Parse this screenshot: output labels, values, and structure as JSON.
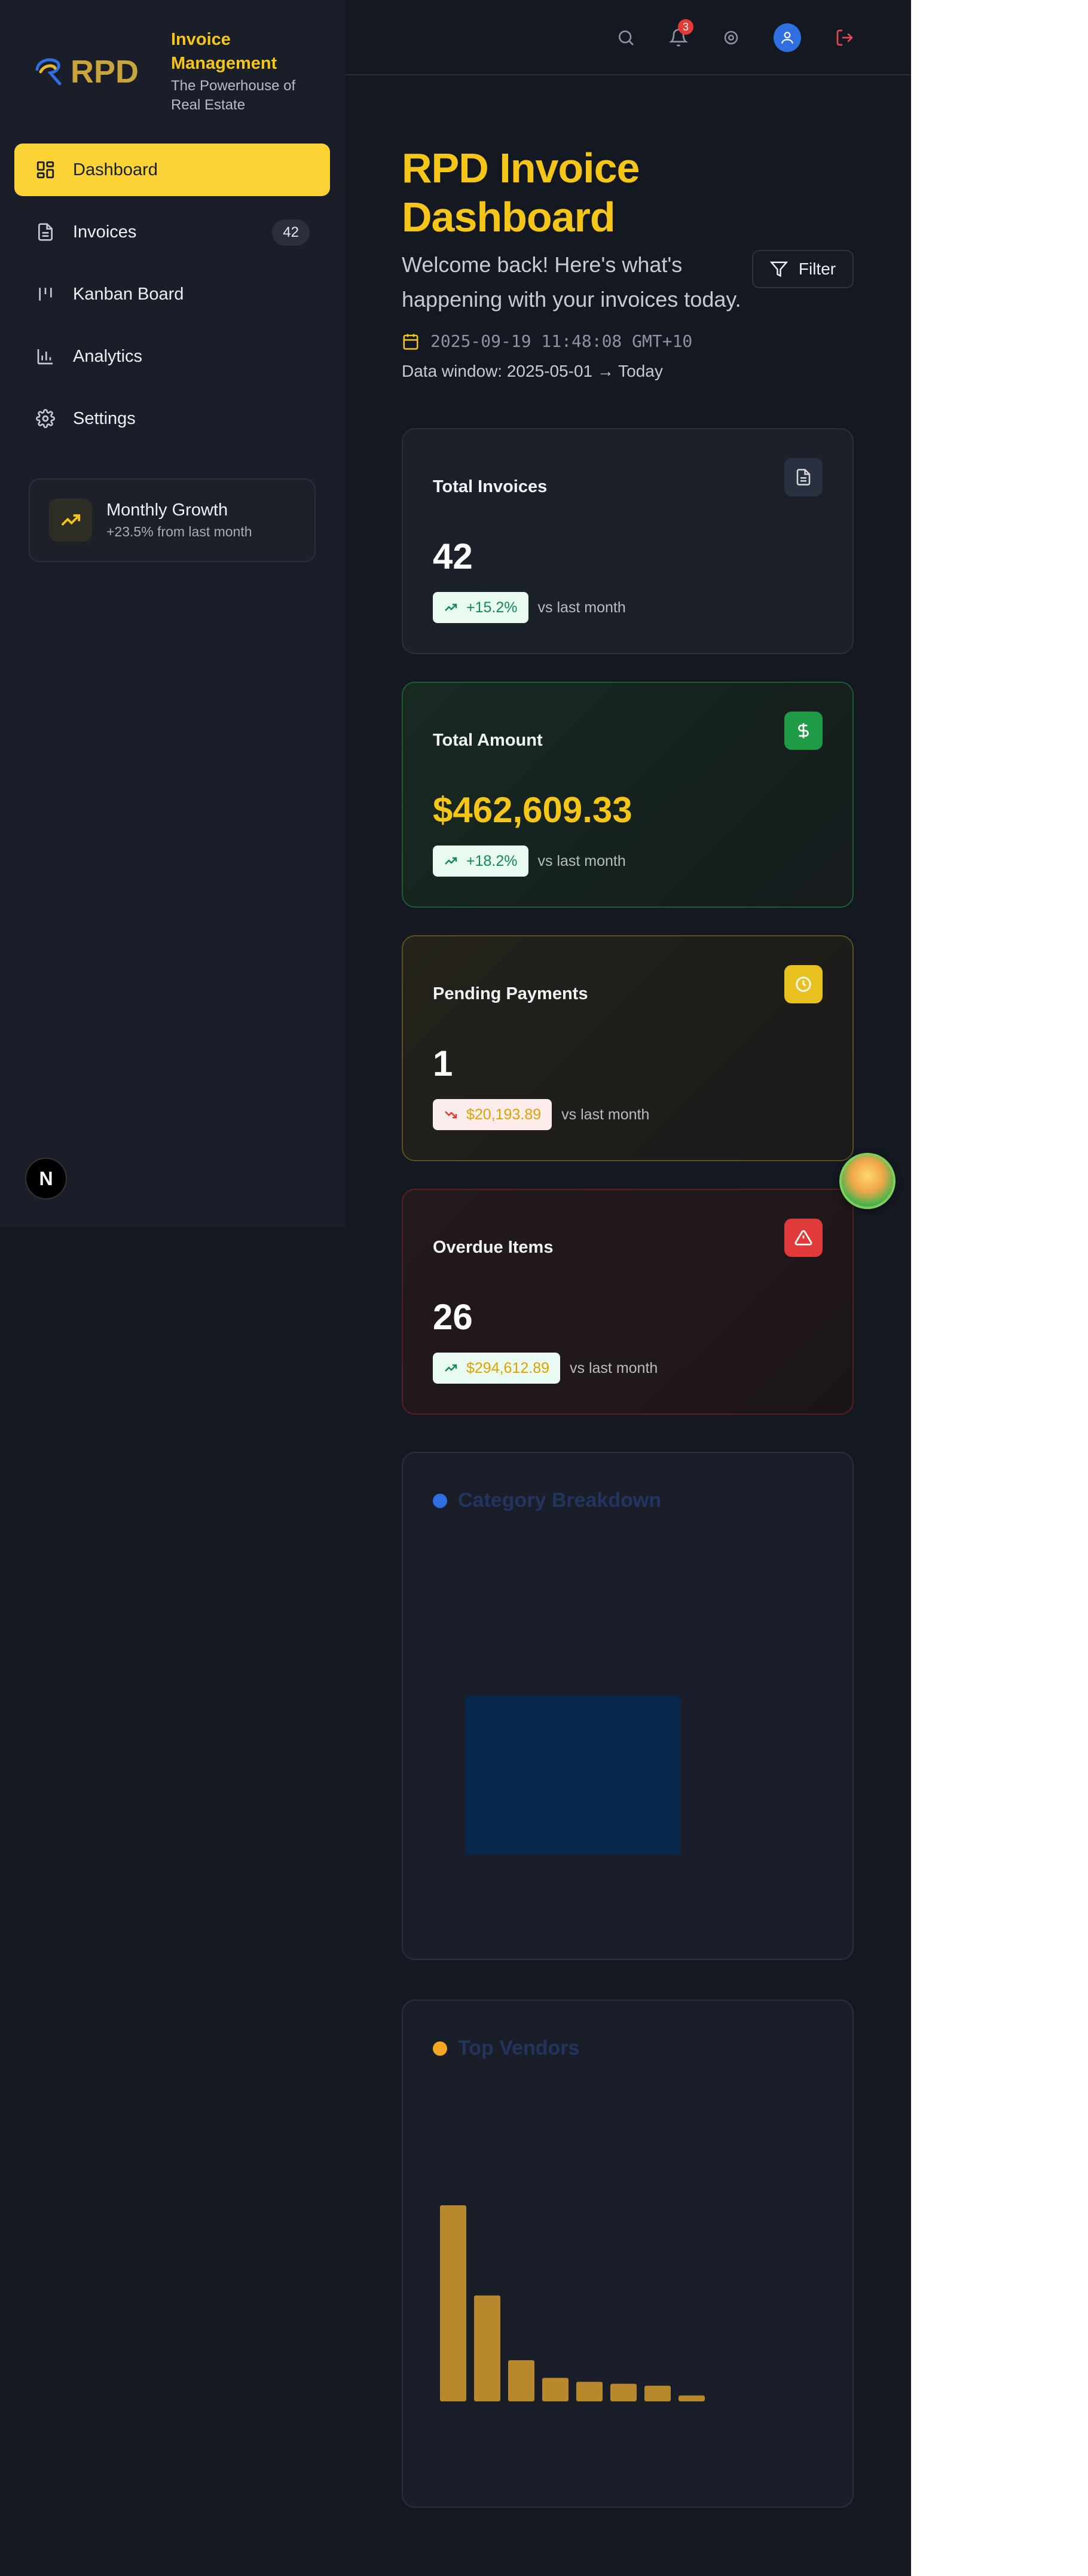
{
  "brand": {
    "logo_text": "RPD",
    "title": "Invoice Management",
    "subtitle": "The Powerhouse of Real Estate"
  },
  "nav": {
    "items": [
      {
        "label": "Dashboard",
        "icon": "grid-icon",
        "active": true
      },
      {
        "label": "Invoices",
        "icon": "file-icon",
        "badge": "42"
      },
      {
        "label": "Kanban Board",
        "icon": "kanban-icon"
      },
      {
        "label": "Analytics",
        "icon": "bar-chart-icon"
      },
      {
        "label": "Settings",
        "icon": "gear-icon"
      }
    ]
  },
  "growth": {
    "title": "Monthly Growth",
    "subtitle": "+23.5% from last month"
  },
  "next_badge": "N",
  "topbar": {
    "notification_count": "3"
  },
  "page": {
    "title": "RPD Invoice Dashboard",
    "welcome": "Welcome back! Here's what's happening with your invoices today.",
    "filter_label": "Filter",
    "datetime": "2025-09-19 11:48:08 GMT+10",
    "data_window": "Data window: 2025-05-01 → Today"
  },
  "cards": [
    {
      "title": "Total Invoices",
      "value": "42",
      "change": "+15.2%",
      "vs": "vs last month",
      "accent": "#2a3040"
    },
    {
      "title": "Total Amount",
      "value": "$462,609.33",
      "change": "+18.2%",
      "vs": "vs last month",
      "accent": "#1f9a45"
    },
    {
      "title": "Pending Payments",
      "value": "1",
      "change": "$20,193.89",
      "vs": "vs last month",
      "accent": "#e8c020"
    },
    {
      "title": "Overdue Items",
      "value": "26",
      "change": "$294,612.89",
      "vs": "vs last month",
      "accent": "#e03a3a"
    }
  ],
  "charts": {
    "category": {
      "title": "Category Breakdown",
      "dot_color": "#2f6fe0"
    },
    "vendors": {
      "title": "Top Vendors",
      "dot_color": "#f5a623"
    }
  },
  "chart_data": [
    {
      "type": "bar",
      "title": "Category Breakdown",
      "categories": [
        ""
      ],
      "values": [
        1
      ]
    },
    {
      "type": "bar",
      "title": "Top Vendors",
      "categories": [
        "",
        "",
        "",
        "",
        "",
        "",
        "",
        ""
      ],
      "values": [
        100,
        54,
        21,
        12,
        10,
        9,
        8,
        3
      ]
    }
  ]
}
